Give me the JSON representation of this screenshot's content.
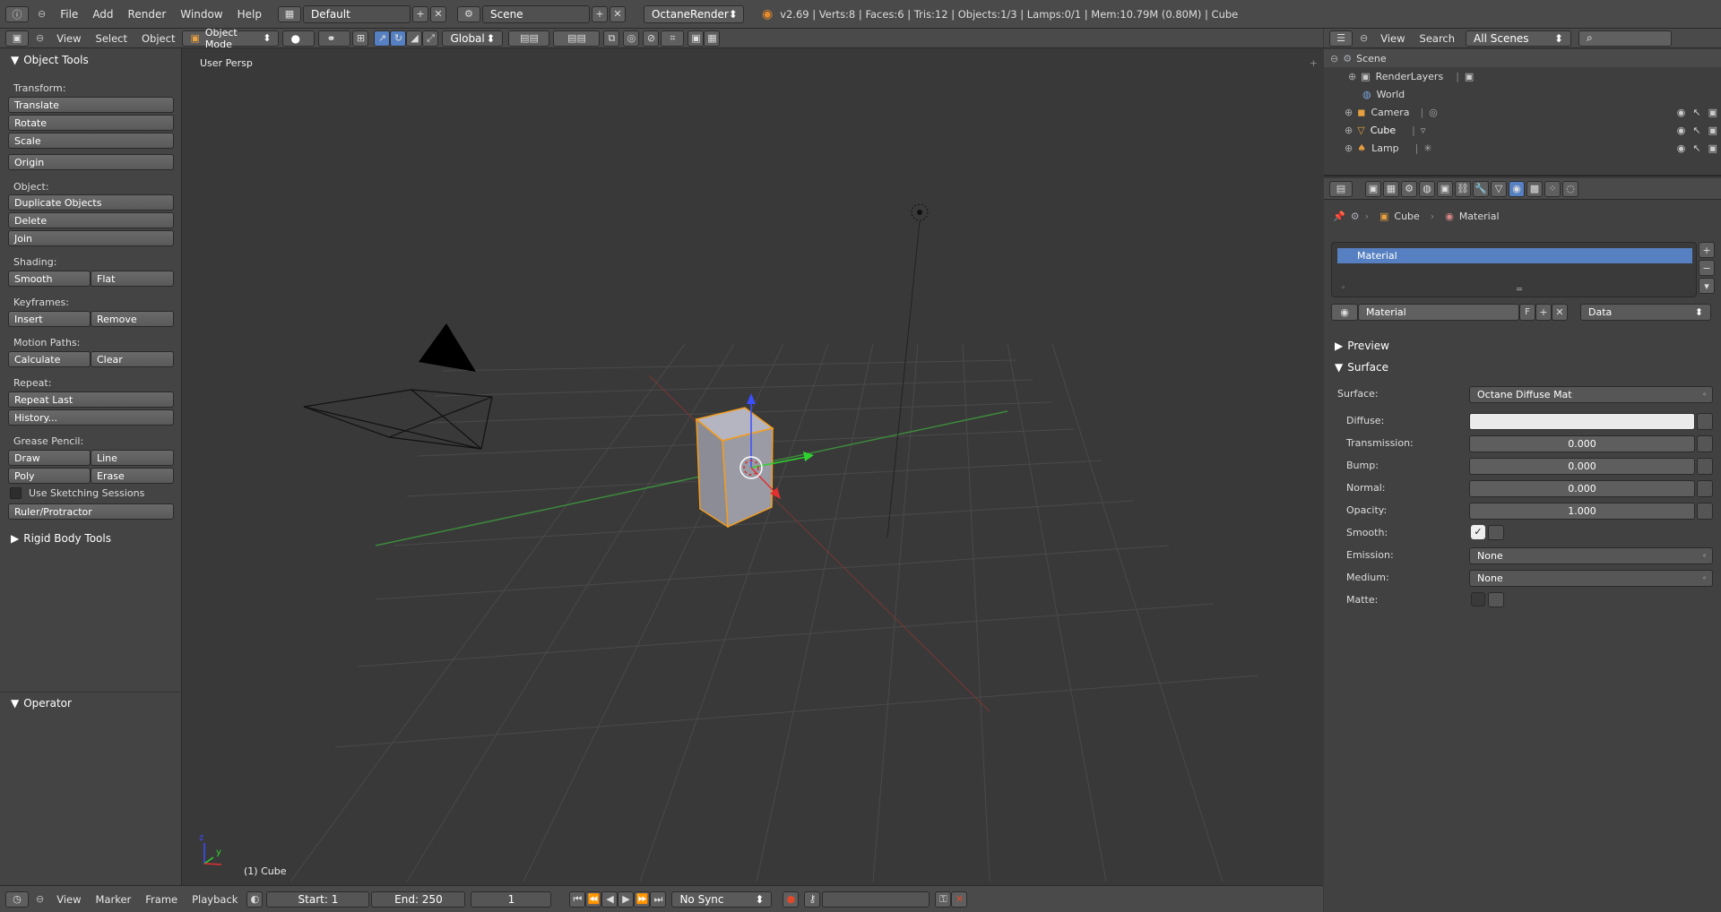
{
  "topbar": {
    "menus": [
      "File",
      "Add",
      "Render",
      "Window",
      "Help"
    ],
    "layout": "Default",
    "scene": "Scene",
    "engine": "OctaneRender",
    "stats": "v2.69 | Verts:8 | Faces:6 | Tris:12 | Objects:1/3 | Lamps:0/1 | Mem:10.79M (0.80M) | Cube"
  },
  "viewport_header": {
    "menus": [
      "View",
      "Select",
      "Object"
    ],
    "mode": "Object Mode",
    "orientation": "Global"
  },
  "toolshelf": {
    "title": "Object Tools",
    "transform_label": "Transform:",
    "translate": "Translate",
    "rotate": "Rotate",
    "scale": "Scale",
    "origin": "Origin",
    "object_label": "Object:",
    "duplicate": "Duplicate Objects",
    "delete": "Delete",
    "join": "Join",
    "shading_label": "Shading:",
    "smooth": "Smooth",
    "flat": "Flat",
    "keyframes_label": "Keyframes:",
    "insert": "Insert",
    "remove": "Remove",
    "motion_label": "Motion Paths:",
    "calculate": "Calculate",
    "clear": "Clear",
    "repeat_label": "Repeat:",
    "repeat_last": "Repeat Last",
    "history": "History...",
    "grease_label": "Grease Pencil:",
    "draw": "Draw",
    "line": "Line",
    "poly": "Poly",
    "erase": "Erase",
    "sketch": "Use Sketching Sessions",
    "ruler": "Ruler/Protractor",
    "rigid": "Rigid Body Tools",
    "operator": "Operator"
  },
  "viewport": {
    "view_label": "User Persp",
    "object_label": "(1) Cube"
  },
  "timeline": {
    "menus": [
      "View",
      "Marker",
      "Frame",
      "Playback"
    ],
    "start": "Start: 1",
    "end": "End: 250",
    "current": "1",
    "sync": "No Sync"
  },
  "outliner": {
    "menus": [
      "View",
      "Search"
    ],
    "filter": "All Scenes",
    "items": [
      "Scene",
      "RenderLayers",
      "World",
      "Camera",
      "Cube",
      "Lamp"
    ]
  },
  "properties": {
    "breadcrumb_object": "Cube",
    "breadcrumb_material": "Material",
    "slot": "Material",
    "material_name": "Material",
    "fake_user": "F",
    "link": "Data",
    "preview": "Preview",
    "surface_panel": "Surface",
    "surface_label": "Surface:",
    "surface_value": "Octane Diffuse Mat",
    "diffuse_label": "Diffuse:",
    "transmission_label": "Transmission:",
    "transmission": "0.000",
    "bump_label": "Bump:",
    "bump": "0.000",
    "normal_label": "Normal:",
    "normal": "0.000",
    "opacity_label": "Opacity:",
    "opacity": "1.000",
    "smooth_label": "Smooth:",
    "emission_label": "Emission:",
    "emission": "None",
    "medium_label": "Medium:",
    "medium": "None",
    "matte_label": "Matte:"
  }
}
